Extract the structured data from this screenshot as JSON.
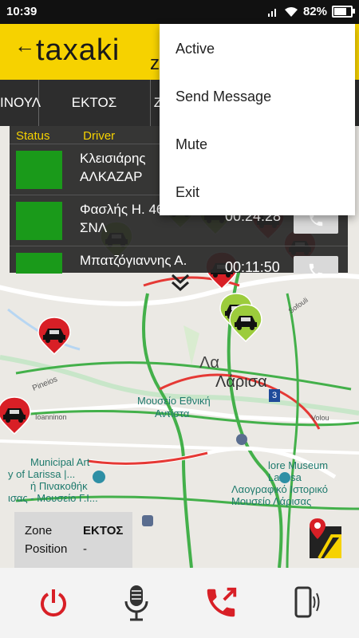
{
  "status_bar": {
    "time": "10:39",
    "battery": "82%",
    "battery_level": 0.82
  },
  "app": {
    "logo": "taxaki",
    "zone_letter": "z"
  },
  "tabs": [
    "ΙΝΟΥΛ",
    "ΕΚΤΟΣ",
    "Ζ"
  ],
  "drivers_panel": {
    "headers": {
      "status": "Status",
      "driver": "Driver"
    },
    "rows": [
      {
        "name_line1": "Κλεισιάρης",
        "name_line2": "ΑΛΚΑΖΑΡ",
        "time": "",
        "status_color": "#1a9a1a"
      },
      {
        "name_line1": "Φασλής Η. 464",
        "name_line2": "ΣΝΛ",
        "time": "00:24:28",
        "status_color": "#1a9a1a"
      },
      {
        "name_line1": "Μπατζόγιαννης Α.",
        "name_line2": "",
        "time": "00:11:50",
        "status_color": "#1a9a1a"
      }
    ]
  },
  "map_labels": {
    "city": "Λάρισα",
    "city_prefix": "Λα",
    "museum1_line1": "Μουσείο Εθνική",
    "museum1_line2": "Αντίστα",
    "municipal_line1": "Municipal Art",
    "municipal_line2": "y of Larissa |...",
    "municipal_line3": "ή Πινακοθήκ",
    "municipal_line4": "ισας - Μουσείο Γ.Ι...",
    "folklore_line1": "lore Museum",
    "folklore_line2": "Larissa",
    "folklore_line3": "Λαογραφικό Ιστορικό",
    "folklore_line4": "Μουσείο Λάρισας",
    "street_pineios": "Pineios",
    "street_ioannina": "Ioanninon",
    "street_volou": "Volou",
    "street_sofoulis": "Sofouli",
    "badge_3": "3"
  },
  "zone_info": {
    "zone_label": "Zone",
    "zone_value": "ΕΚΤΟΣ",
    "position_label": "Position",
    "position_value": "-"
  },
  "context_menu": {
    "items": [
      "Active",
      "Send Message",
      "Mute",
      "Exit"
    ]
  },
  "colors": {
    "accent": "#f6d200",
    "free_taxi": "#9ccc3c",
    "busy_taxi": "#d81f26",
    "status_green": "#1a9a1a",
    "action_red": "#d81f26"
  },
  "icons": [
    "power-icon",
    "microphone-icon",
    "phone-outgoing-icon",
    "phone-vibrate-icon",
    "directions-map-icon",
    "chevron-double-down-icon",
    "phone-icon"
  ]
}
